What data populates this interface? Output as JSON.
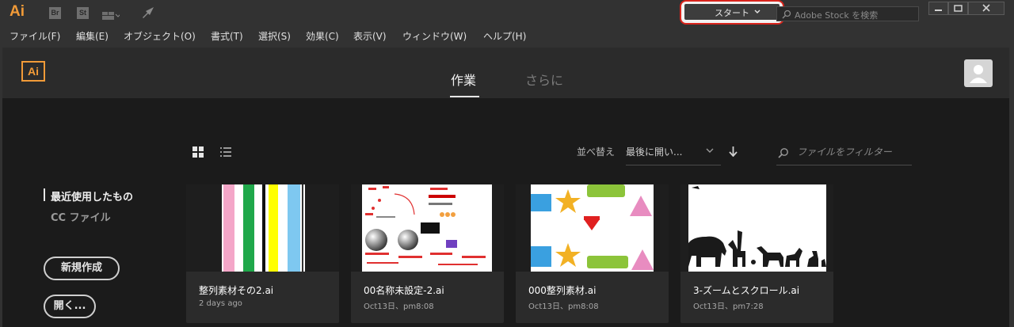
{
  "titlebar": {
    "app_logo": "Ai",
    "bridge_icon": "Br",
    "stock_icon": "St",
    "workspace_label": "スタート",
    "stock_search_placeholder": "Adobe Stock を検索"
  },
  "menu": [
    "ファイル(F)",
    "編集(E)",
    "オブジェクト(O)",
    "書式(T)",
    "選択(S)",
    "効果(C)",
    "表示(V)",
    "ウィンドウ(W)",
    "ヘルプ(H)"
  ],
  "home": {
    "logo": "Ai",
    "tabs": [
      "作業",
      "さらに"
    ],
    "sort_label": "並べ替え",
    "sort_value": "最後に開い...",
    "filter_placeholder": "ファイルをフィルター",
    "sidebar": [
      "最近使用したもの",
      "CC ファイル"
    ],
    "new_button": "新規作成",
    "open_button": "開く..."
  },
  "files": [
    {
      "name": "整列素材その2.ai",
      "date": "2 days ago"
    },
    {
      "name": "00名称未設定-2.ai",
      "date": "Oct13日、pm8:08"
    },
    {
      "name": "000整列素材.ai",
      "date": "Oct13日、pm8:08"
    },
    {
      "name": "3-ズームとスクロール.ai",
      "date": "Oct13日、pm7:28"
    }
  ],
  "colors": {
    "accent_orange": "#f29b38",
    "highlight_red": "#d9241c"
  }
}
